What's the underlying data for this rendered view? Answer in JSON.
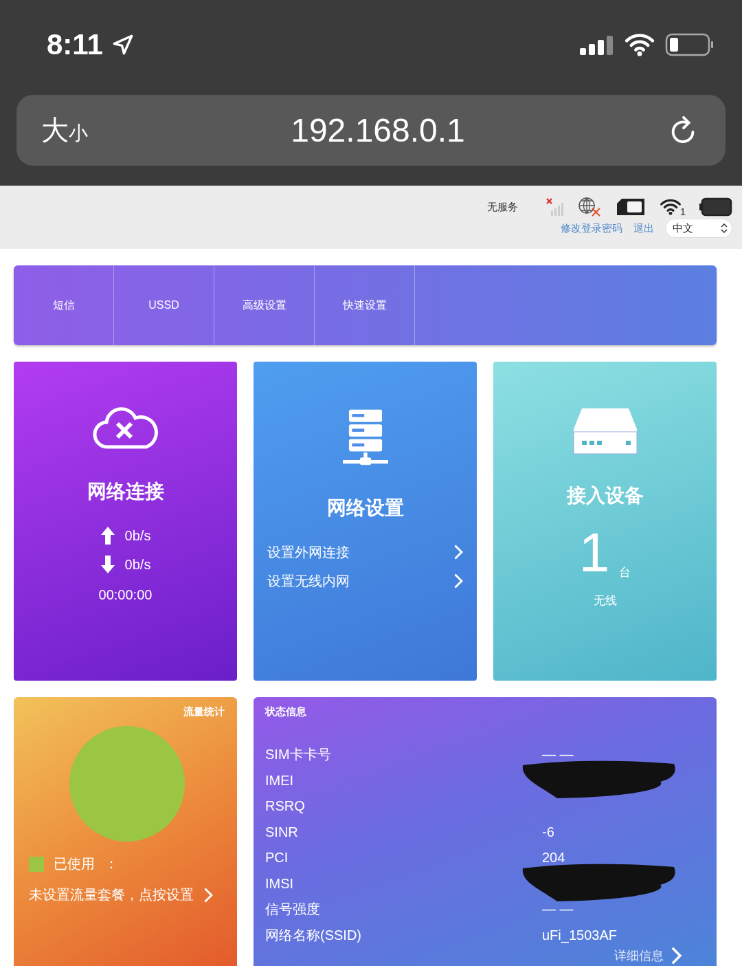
{
  "phone_status": {
    "time": "8:11"
  },
  "browser": {
    "size_large": "大",
    "size_small": "小",
    "url": "192.168.0.1"
  },
  "header": {
    "service": "无服务",
    "wifi_clients": "1",
    "links": [
      "修改登录密码",
      "退出"
    ],
    "language": "中文"
  },
  "nav": [
    {
      "label": "短信",
      "selected": false
    },
    {
      "label": "USSD",
      "selected": false
    },
    {
      "label": "高级设置",
      "selected": false
    },
    {
      "label": "快速设置",
      "selected": false
    }
  ],
  "cards": [
    {
      "kind": "connection",
      "title": "网络连接",
      "upload": "0b/s",
      "download": "0b/s",
      "duration": "00:00:00"
    },
    {
      "kind": "network",
      "title": "网络设置",
      "links": [
        "设置外网连接",
        "设置无线内网"
      ]
    },
    {
      "kind": "devices",
      "title": "接入设备",
      "count": "1",
      "unit": "台",
      "type": "无线"
    }
  ],
  "traffic": {
    "title": "流量统计",
    "legend": "已使用",
    "legend_sep": "：",
    "color": "#9bc644",
    "prompt": "未设置流量套餐，点按设置"
  },
  "status": {
    "title": "状态信息",
    "rows": [
      {
        "label": "SIM卡卡号",
        "value": "— —",
        "redacted": false
      },
      {
        "label": "IMEI",
        "redacted": true
      },
      {
        "label": "RSRQ",
        "redacted": false
      },
      {
        "label": "SINR",
        "value": "-6",
        "redacted": false
      },
      {
        "label": "PCI",
        "value": "204",
        "redacted": false
      },
      {
        "label": "IMSI",
        "redacted": true
      },
      {
        "label": "信号强度",
        "value": "— —",
        "redacted": false
      },
      {
        "label": "网络名称(SSID)",
        "value": "uFi_1503AF",
        "redacted": false
      }
    ],
    "more": "详细信息"
  }
}
